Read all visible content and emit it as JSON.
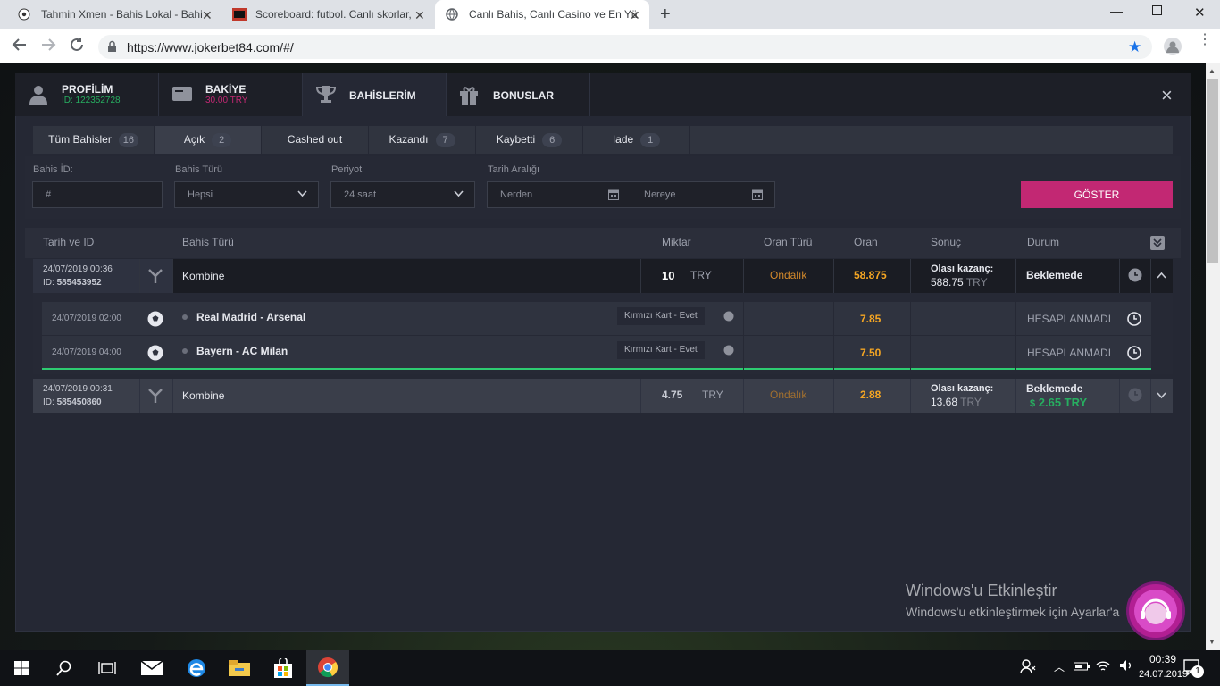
{
  "browser": {
    "tabs": [
      {
        "title": "Tahmin Xmen - Bahis Lokal - Bahi"
      },
      {
        "title": "Scoreboard: futbol. Canlı skorlar,"
      },
      {
        "title": "Canlı Bahis, Canlı Casino ve En Yü"
      }
    ],
    "tab_icons": [
      "soccer-ball",
      "sb-logo",
      "globe"
    ],
    "url": "https://www.jokerbet84.com/#/"
  },
  "nav": {
    "profile": {
      "label": "PROFİLİM",
      "sub": "ID: 122352728"
    },
    "balance": {
      "label": "BAKİYE",
      "sub": "30.00 TRY"
    },
    "bets": {
      "label": "BAHİSLERİM"
    },
    "bonus": {
      "label": "BONUSLAR"
    },
    "close": "×"
  },
  "subtabs": [
    {
      "label": "Tüm Bahisler",
      "count": "16"
    },
    {
      "label": "Açık",
      "count": "2"
    },
    {
      "label": "Cashed out",
      "count": ""
    },
    {
      "label": "Kazandı",
      "count": "7"
    },
    {
      "label": "Kaybetti",
      "count": "6"
    },
    {
      "label": "Iade",
      "count": "1"
    }
  ],
  "filters": {
    "bet_id": {
      "label": "Bahis İD:",
      "placeholder": "#"
    },
    "bet_type": {
      "label": "Bahis Türü",
      "value": "Hepsi"
    },
    "period": {
      "label": "Periyot",
      "value": "24 saat"
    },
    "date_range": {
      "label": "Tarih Aralığı",
      "from": "Nerden",
      "to": "Nereye"
    },
    "show_button": "GÖSTER"
  },
  "table": {
    "headers": [
      "Tarih ve ID",
      "Bahis Türü",
      "Miktar",
      "Oran Türü",
      "Oran",
      "Sonuç",
      "Durum"
    ],
    "bets": [
      {
        "date": "24/07/2019 00:36",
        "id_label": "ID:",
        "id": "585453952",
        "type": "Kombine",
        "amount": "10",
        "currency": "TRY",
        "odds_type": "Ondalık",
        "odds": "58.875",
        "result_label": "Olası kazanç:",
        "result_value": "588.75",
        "result_currency": "TRY",
        "status": "Beklemede",
        "cashout": ""
      },
      {
        "date": "24/07/2019 00:31",
        "id_label": "ID:",
        "id": "585450860",
        "type": "Kombine",
        "amount": "4.75",
        "currency": "TRY",
        "odds_type": "Ondalık",
        "odds": "2.88",
        "result_label": "Olası kazanç:",
        "result_value": "13.68",
        "result_currency": "TRY",
        "status": "Beklemede",
        "cashout": "2.65 TRY"
      }
    ],
    "legs": [
      {
        "date": "24/07/2019 02:00",
        "match": "Real Madrid - Arsenal",
        "market": "Kırmızı Kart - Evet",
        "odds": "7.85",
        "status": "HESAPLANMADI"
      },
      {
        "date": "24/07/2019 04:00",
        "match": "Bayern - AC Milan",
        "market": "Kırmızı Kart - Evet",
        "odds": "7.50",
        "status": "HESAPLANMADI"
      }
    ]
  },
  "watermark": {
    "title": "Windows'u Etkinleştir",
    "text": "Windows'u etkinleştirmek için Ayarlar'a"
  },
  "taskbar": {
    "time": "00:39",
    "date": "24.07.2019",
    "notifications": "1"
  },
  "colors": {
    "accent": "#c22873",
    "odds": "#f5a623",
    "positive": "#27ae60"
  }
}
